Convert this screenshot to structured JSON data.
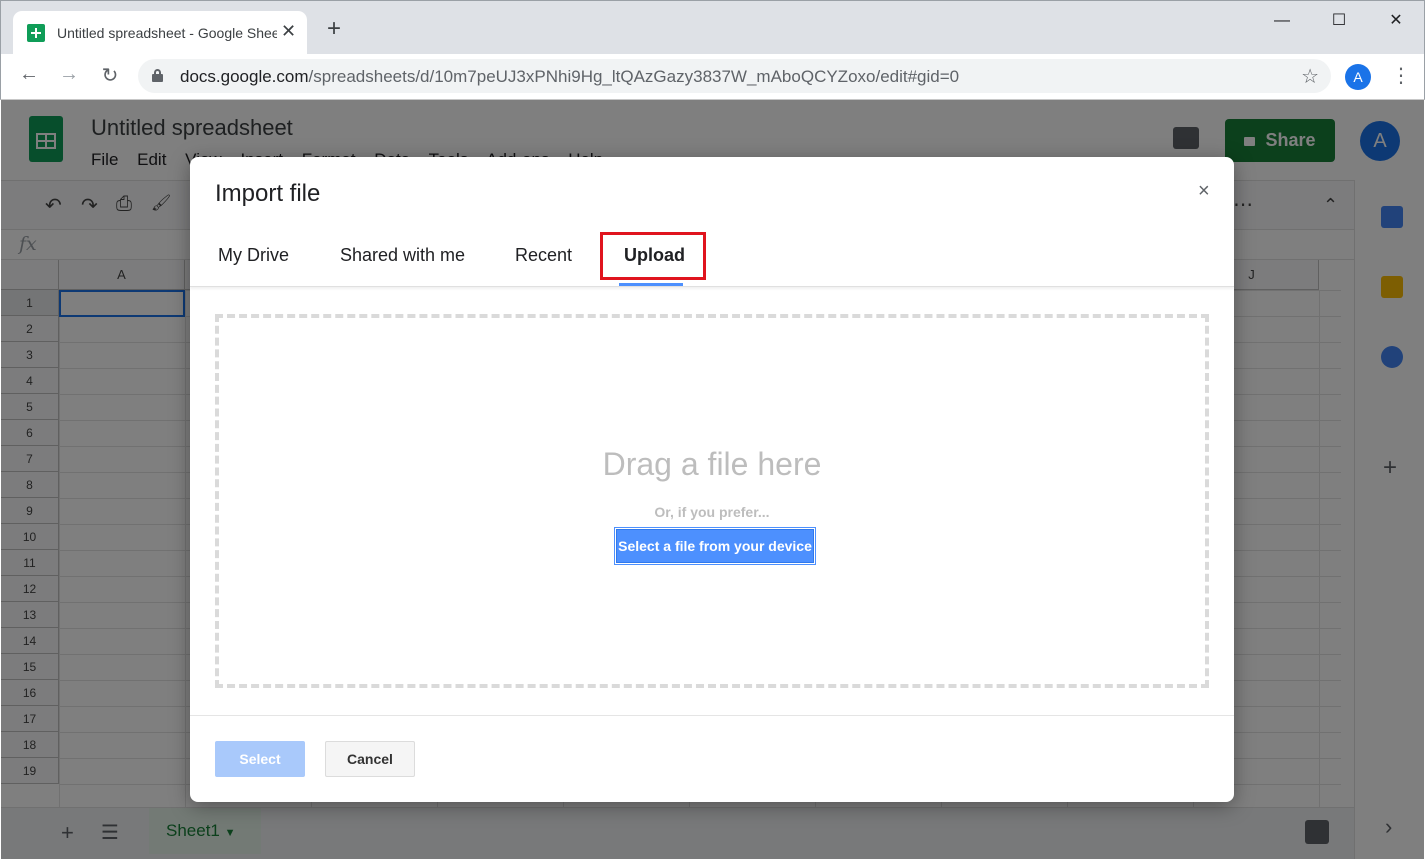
{
  "browser": {
    "tab_title": "Untitled spreadsheet - Google Sheets",
    "new_tab_icon": "+",
    "tab_close_icon": "✕",
    "minimize_icon": "—",
    "maximize_icon": "☐",
    "close_icon": "✕",
    "back_icon": "←",
    "forward_icon": "→",
    "reload_icon": "↻",
    "url_host": "docs.google.com",
    "url_path": "/spreadsheets/d/10m7peUJ3xPNhi9Hg_ltQAzGazy3837W_mAboQCYZoxo/edit#gid=0",
    "star_icon": "☆",
    "profile_initial": "A",
    "menu_icon": "⋮"
  },
  "sheets": {
    "doc_title": "Untitled spreadsheet",
    "menu": [
      "File",
      "Edit",
      "View",
      "Insert",
      "Format",
      "Data",
      "Tools",
      "Add-ons",
      "Help"
    ],
    "share_label": "Share",
    "avatar_initial": "A",
    "fx_label": "fx",
    "toolbar_icons": {
      "undo": "↶",
      "redo": "↷",
      "print": "⎙",
      "paint_format": "🖌",
      "more": "⋯",
      "collapse": "⌃"
    },
    "columns": [
      "A",
      "J"
    ],
    "rows": [
      "1",
      "2",
      "3",
      "4",
      "5",
      "6",
      "7",
      "8",
      "9",
      "10",
      "11",
      "12",
      "13",
      "14",
      "15",
      "16",
      "17",
      "18",
      "19"
    ],
    "sheet_tab": "Sheet1",
    "add_sheet_icon": "+",
    "all_sheets_icon": "☰",
    "side_add_icon": "+",
    "side_expand_icon": "›"
  },
  "dialog": {
    "title": "Import file",
    "close_icon": "×",
    "tabs": [
      "My Drive",
      "Shared with me",
      "Recent",
      "Upload"
    ],
    "active_tab": "Upload",
    "drop_text": "Drag a file here",
    "prefer_text": "Or, if you prefer...",
    "select_device_label": "Select a file from your device",
    "select_label": "Select",
    "cancel_label": "Cancel"
  },
  "colors": {
    "accent_blue": "#4d90fe",
    "highlight_red": "#e0141e",
    "sheets_green": "#0f9d58",
    "share_green": "#188038"
  }
}
